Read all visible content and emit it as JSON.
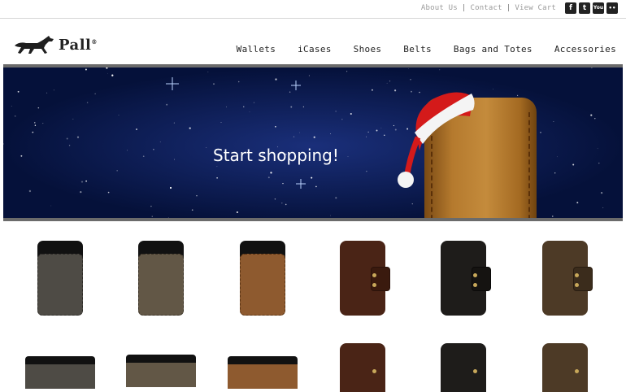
{
  "top_links": [
    {
      "label": "About Us"
    },
    {
      "label": "Contact"
    },
    {
      "label": "View Cart"
    }
  ],
  "social_icons": [
    "facebook-icon",
    "twitter-icon",
    "youtube-icon",
    "flickr-icon"
  ],
  "social_glyphs": {
    "facebook": "f",
    "twitter": "t",
    "youtube": "You",
    "flickr": "••"
  },
  "brand": {
    "name": "Pall",
    "trademark": "®"
  },
  "nav": [
    {
      "label": "Wallets"
    },
    {
      "label": "iCases"
    },
    {
      "label": "Shoes"
    },
    {
      "label": "Belts"
    },
    {
      "label": "Bags and Totes"
    },
    {
      "label": "Accessories"
    }
  ],
  "banner": {
    "headline": "Start shopping!"
  },
  "colors": {
    "banner_bg": "#05113a",
    "divider": "#6b6b6b",
    "santa_red": "#d41a1a"
  },
  "products_row1": [
    {
      "style": "sleeve",
      "color": "#4e4b45"
    },
    {
      "style": "sleeve",
      "color": "#625746"
    },
    {
      "style": "sleeve",
      "color": "#8e5a2f"
    },
    {
      "style": "flap",
      "color": "#4a2416"
    },
    {
      "style": "flap",
      "color": "#1e1c1a"
    },
    {
      "style": "flap",
      "color": "#4d3a26"
    }
  ]
}
